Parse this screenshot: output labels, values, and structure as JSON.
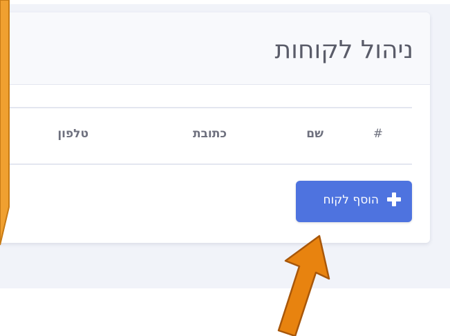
{
  "page": {
    "title": "ניהול לקוחות"
  },
  "table": {
    "columns": [
      "#",
      "שם",
      "כתובת",
      "טלפון"
    ]
  },
  "add_button": {
    "label": "הוסף לקוח",
    "icon": "plus-icon"
  },
  "colors": {
    "primary": "#4e73df",
    "annotation_orange": "#e8830f",
    "side_orange": "#f0a030",
    "header_text": "#5a5c69",
    "column_text": "#6e707e"
  }
}
